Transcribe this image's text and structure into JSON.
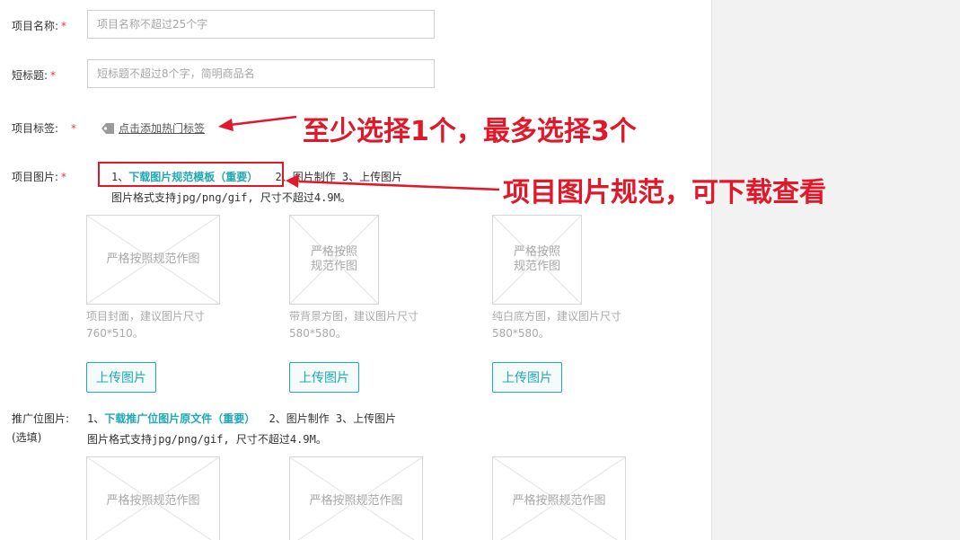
{
  "fields": {
    "name": {
      "label": "项目名称:",
      "placeholder": "项目名称不超过25个字"
    },
    "short_title": {
      "label": "短标题:",
      "placeholder": "短标题不超过8个字，简明商品名"
    },
    "tags": {
      "label": "项目标签:",
      "link": "点击添加热门标签"
    },
    "images": {
      "label": "项目图片:",
      "step1_prefix": "1、",
      "step1_link": "下载图片规范模板（重要）",
      "step_rest": "2、图片制作 3、上传图片",
      "hint": "图片格式支持jpg/png/gif, 尺寸不超过4.9M。",
      "slots": [
        {
          "placeholder": "严格按照规范作图",
          "caption": "项目封面，建议图片尺寸760*510。",
          "button": "上传图片"
        },
        {
          "placeholder": "严格按照规范作图",
          "caption": "带背景方图，建议图片尺寸580*580。",
          "button": "上传图片"
        },
        {
          "placeholder": "严格按照规范作图",
          "caption": "纯白底方图，建议图片尺寸580*580。",
          "button": "上传图片"
        }
      ]
    },
    "promo_images": {
      "label": "推广位图片:",
      "optional": "(选填)",
      "step1_prefix": "1、",
      "step1_link": "下载推广位图片原文件（重要）",
      "step_rest": "2、图片制作 3、上传图片",
      "hint": "图片格式支持jpg/png/gif, 尺寸不超过4.9M。",
      "slots": [
        {
          "placeholder": "严格按照规范作图"
        },
        {
          "placeholder": "严格按照规范作图"
        },
        {
          "placeholder": "严格按照规范作图"
        }
      ]
    },
    "required_mark": "*"
  },
  "annotations": {
    "tags_note": "至少选择1个，最多选择3个",
    "images_note": "项目图片规范，可下载查看"
  },
  "colors": {
    "accent": "#20a8b5",
    "required": "#e4393c",
    "annotation": "#e0182a",
    "side_panel": "#f2f2f2"
  }
}
